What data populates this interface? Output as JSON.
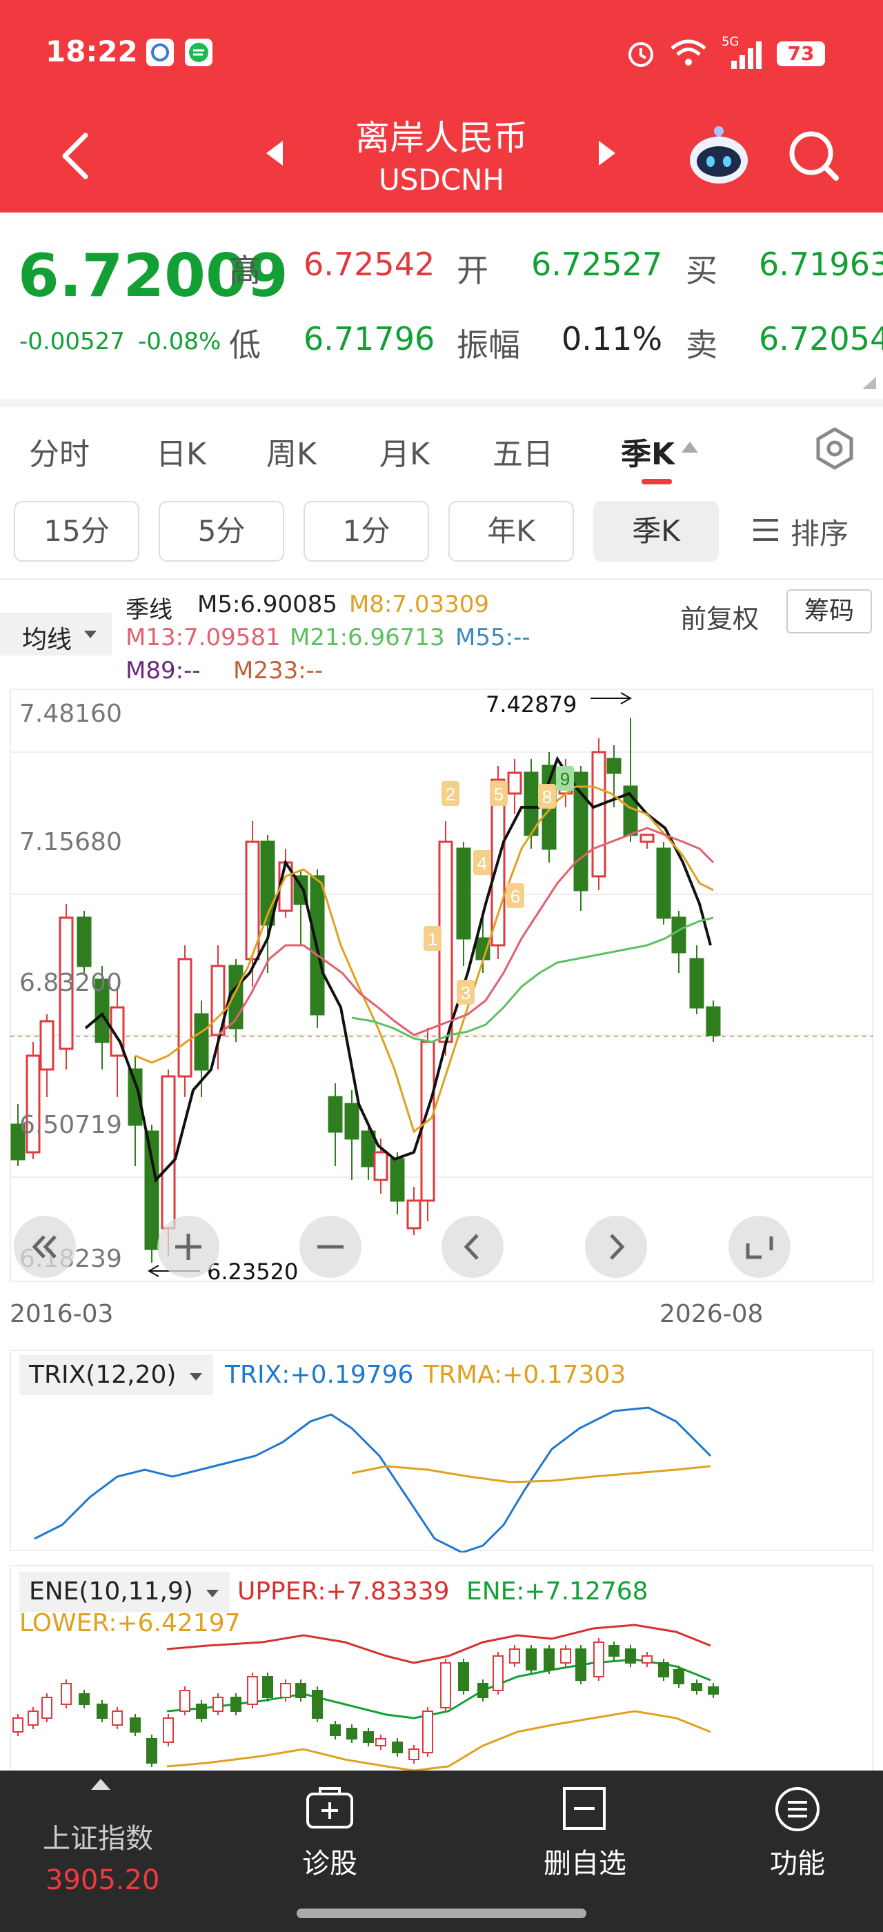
{
  "status": {
    "time": "18:22",
    "battery": "73",
    "net": "5G"
  },
  "header": {
    "title": "离岸人民币",
    "code": "USDCNH"
  },
  "quote": {
    "price": "6.72009",
    "change": "-0.00527",
    "change_pct": "-0.08%",
    "high_label": "高",
    "high": "6.72542",
    "open_label": "开",
    "open": "6.72527",
    "buy_label": "买",
    "buy": "6.71963",
    "low_label": "低",
    "low": "6.71796",
    "amp_label": "振幅",
    "amp": "0.11%",
    "sell_label": "卖",
    "sell": "6.72054"
  },
  "period_tabs": [
    {
      "label": "分时"
    },
    {
      "label": "日K"
    },
    {
      "label": "周K"
    },
    {
      "label": "月K"
    },
    {
      "label": "五日"
    },
    {
      "label": "季K"
    }
  ],
  "interval_buttons": [
    {
      "label": "15分"
    },
    {
      "label": "5分"
    },
    {
      "label": "1分"
    },
    {
      "label": "年K"
    },
    {
      "label": "季K"
    }
  ],
  "sort_label": "排序",
  "ma_panel": {
    "selector": "均线",
    "series_name": "季线",
    "m5": "M5:6.90085",
    "m8": "M8:7.03309",
    "m13": "M13:7.09581",
    "m21": "M21:6.96713",
    "m55": "M55:--",
    "m89": "M89:--",
    "m233": "M233:--",
    "fuquan": "前复权",
    "chouma": "筹码"
  },
  "kline": {
    "y_labels": [
      "7.48160",
      "7.15680",
      "6.83200",
      "6.50719",
      "6.18239"
    ],
    "high_annot": "7.42879",
    "low_annot": "6.23520",
    "x_start": "2016-03",
    "x_end": "2026-08",
    "markers": [
      "1",
      "2",
      "3",
      "4",
      "5",
      "6",
      "8",
      "9"
    ]
  },
  "trix": {
    "selector": "TRIX(12,20)",
    "trix": "TRIX:+0.19796",
    "trma": "TRMA:+0.17303"
  },
  "ene": {
    "selector": "ENE(10,11,9)",
    "upper": "UPPER:+7.83339",
    "ene": "ENE:+7.12768",
    "lower": "LOWER:+6.42197"
  },
  "bottom_nav": {
    "index_name": "上证指数",
    "index_value": "3905.20",
    "items": [
      {
        "label": "诊股"
      },
      {
        "label": "删自选"
      },
      {
        "label": "功能"
      }
    ]
  },
  "colors": {
    "brand": "#f03a40",
    "up": "#e0393e",
    "down": "#12a035",
    "m5": "#111111",
    "m8": "#e0a020",
    "m13": "#e06070",
    "m21": "#5cc060",
    "trix": "#1e78d0",
    "trma": "#e0a020"
  }
}
